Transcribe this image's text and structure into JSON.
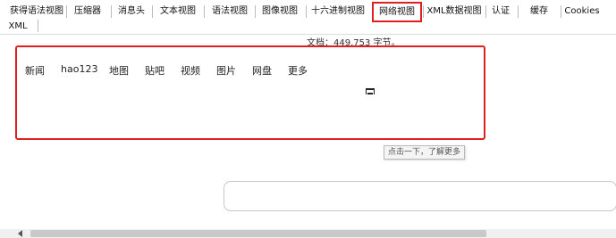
{
  "tabs": [
    {
      "label": "获得语法视图"
    },
    {
      "label": "压缩器"
    },
    {
      "label": "消息头"
    },
    {
      "label": "文本视图"
    },
    {
      "label": "语法视图"
    },
    {
      "label": "图像视图"
    },
    {
      "label": "十六进制视图"
    },
    {
      "label": "网络视图",
      "active": true
    },
    {
      "label": "XML数据视图"
    },
    {
      "label": "认证"
    },
    {
      "label": "缓存"
    },
    {
      "label": "Cookies"
    },
    {
      "label": "XML"
    }
  ],
  "doc_info": "文档：449,753 字节。",
  "preview": {
    "nav_links": [
      "新闻",
      "hao123",
      "地图",
      "贴吧",
      "视频",
      "图片",
      "网盘",
      "更多"
    ]
  },
  "tooltip": "点击一下，了解更多",
  "colors": {
    "highlight": "#e02020",
    "tab_separator": "#bcbcbc"
  }
}
